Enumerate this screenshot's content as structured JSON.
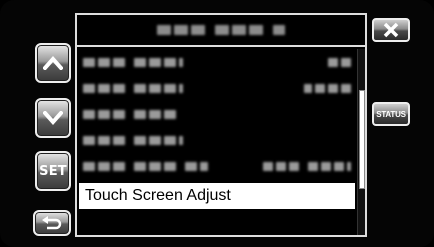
{
  "menu": {
    "selected_item_label": "Touch Screen Adjust"
  },
  "buttons": {
    "set_label": "SET",
    "status_label": "STATUS"
  },
  "scroll": {
    "position_fraction": 0.47,
    "visible_fraction": 0.53
  },
  "icons": {
    "up": "chevron-up-icon",
    "down": "chevron-down-icon",
    "back": "return-arrow-icon",
    "close": "close-icon"
  }
}
